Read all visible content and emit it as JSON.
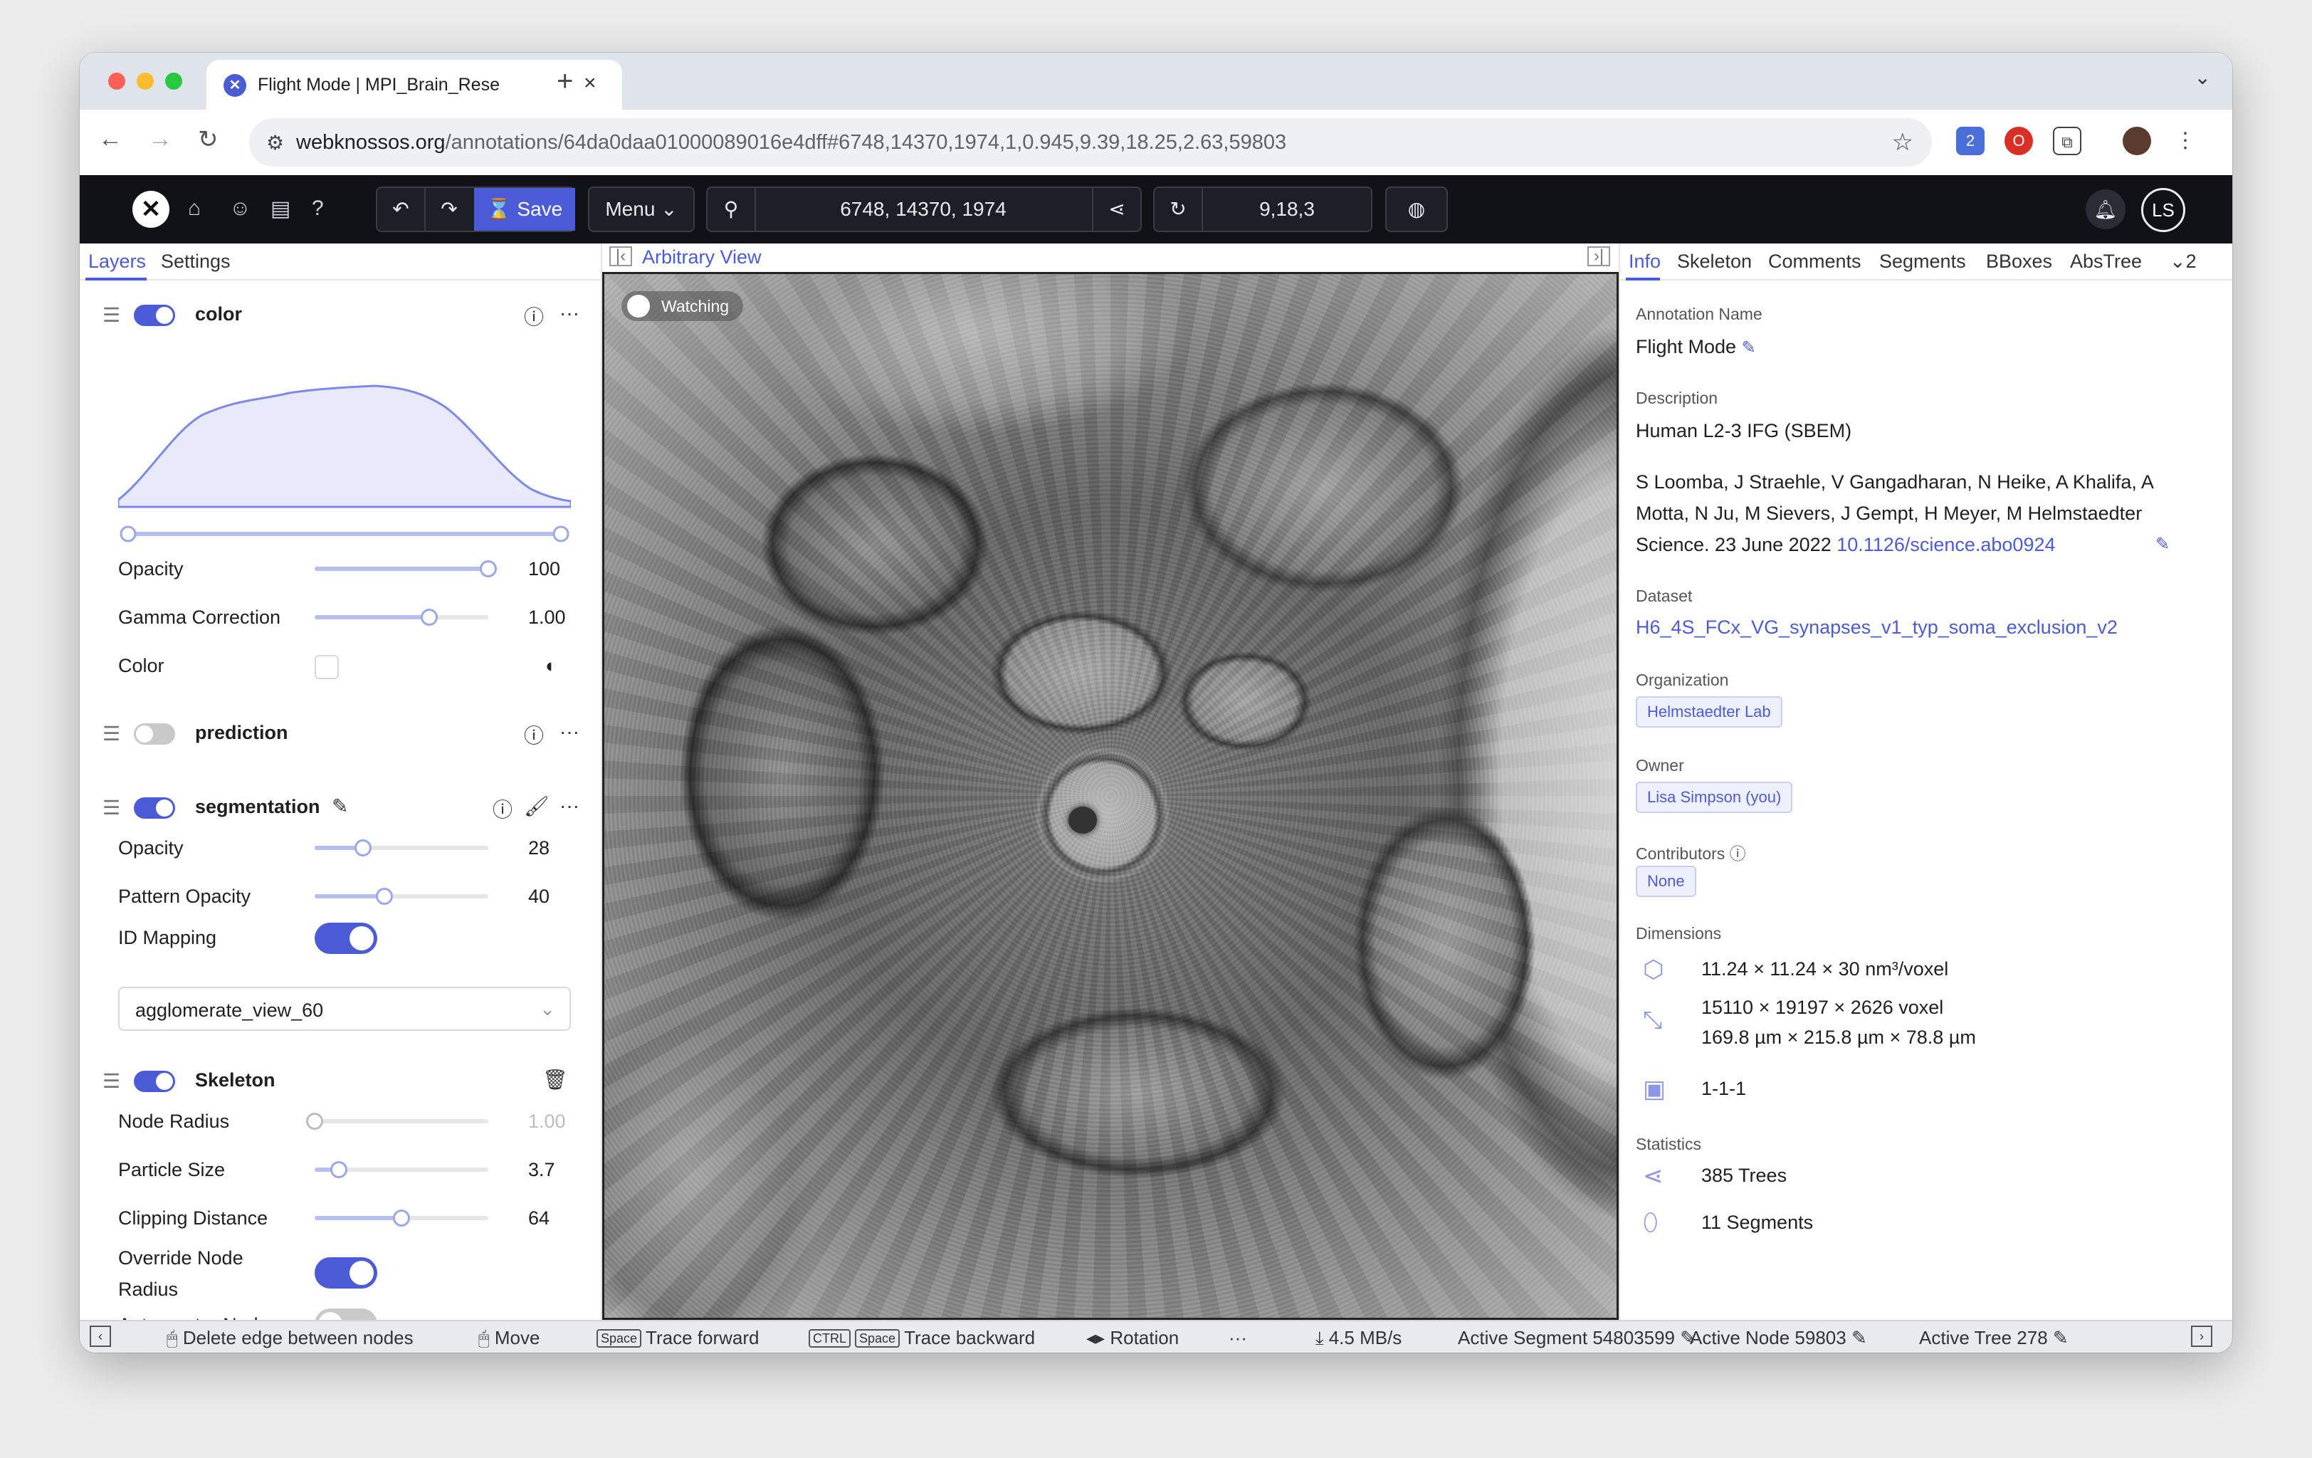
{
  "browser": {
    "tab_title": "Flight Mode | MPI_Brain_Rese",
    "new_tab_symbol": "+",
    "url_host": "webknossos.org",
    "url_path": "/annotations/64da0daa01000089016e4dff#6748,14370,1974,1,0.945,9.39,18.25,2.63,59803",
    "extension_badge": "2"
  },
  "toolbar": {
    "save_label": "Save",
    "menu_label": "Menu",
    "position": "6748, 14370, 1974",
    "rotation": "9,18,3",
    "avatar_initials": "LS"
  },
  "left_panel": {
    "tabs": [
      "Layers",
      "Settings"
    ],
    "color_layer": {
      "name": "color",
      "opacity_label": "Opacity",
      "opacity_value": "100",
      "opacity_fraction": 1.0,
      "gamma_label": "Gamma Correction",
      "gamma_value": "1.00",
      "gamma_fraction": 0.66,
      "color_label": "Color"
    },
    "prediction_layer": {
      "name": "prediction"
    },
    "segmentation_layer": {
      "name": "segmentation",
      "opacity_label": "Opacity",
      "opacity_value": "28",
      "opacity_fraction": 0.28,
      "pattern_label": "Pattern Opacity",
      "pattern_value": "40",
      "pattern_fraction": 0.4,
      "id_mapping_label": "ID Mapping",
      "mapping_value": "agglomerate_view_60"
    },
    "skeleton_layer": {
      "name": "Skeleton",
      "node_radius_label": "Node Radius",
      "node_radius_value": "1.00",
      "node_radius_fraction": 0.0,
      "particle_label": "Particle Size",
      "particle_value": "3.7",
      "particle_fraction": 0.14,
      "clipping_label": "Clipping Distance",
      "clipping_value": "64",
      "clipping_fraction": 0.5,
      "override_label_1": "Override Node",
      "override_label_2": "Radius",
      "autocenter_label": "Auto-center Nodes"
    }
  },
  "viewport": {
    "title": "Arbitrary View",
    "watching_label": "Watching"
  },
  "right_panel": {
    "tabs": [
      "Info",
      "Skeleton",
      "Comments",
      "Segments",
      "BBoxes",
      "AbsTree"
    ],
    "overflow": "2",
    "annotation_name_label": "Annotation Name",
    "annotation_name": "Flight Mode",
    "description_label": "Description",
    "description_line1": "Human L2-3 IFG (SBEM)",
    "description_line2": "S Loomba, J Straehle, V Gangadharan, N Heike, A Khalifa, A",
    "description_line3": "Motta, N Ju, M Sievers, J Gempt, H Meyer, M Helmstaedter",
    "description_line4": "Science. 23 June 2022",
    "doi": "10.1126/science.abo0924",
    "dataset_label": "Dataset",
    "dataset": "H6_4S_FCx_VG_synapses_v1_typ_soma_exclusion_v2",
    "organization_label": "Organization",
    "organization": "Helmstaedter Lab",
    "owner_label": "Owner",
    "owner": "Lisa Simpson (you)",
    "contributors_label": "Contributors",
    "contributors": "None",
    "dimensions_label": "Dimensions",
    "voxel_size": "11.24 × 11.24 × 30 nm³/voxel",
    "extent_voxel": "15110 × 19197 × 2626 voxel",
    "extent_um": "169.8 µm × 215.8 µm × 78.8 µm",
    "mag": "1-1-1",
    "statistics_label": "Statistics",
    "trees": "385 Trees",
    "segments": "11 Segments"
  },
  "status_bar": {
    "delete_edge": "Delete edge between nodes",
    "move": "Move",
    "space_key": "Space",
    "ctrl_key": "CTRL",
    "trace_forward": "Trace forward",
    "trace_backward": "Trace backward",
    "rotation": "Rotation",
    "more": "···",
    "bandwidth": "4.5 MB/s",
    "active_segment": "Active Segment 54803599",
    "active_node": "Active Node 59803",
    "active_tree": "Active Tree 278"
  },
  "colors": {
    "accent": "#4b5bd6",
    "toolbar_bg": "#111217",
    "histogram_fill": "#e8eafc",
    "histogram_stroke": "#7d89ea"
  }
}
